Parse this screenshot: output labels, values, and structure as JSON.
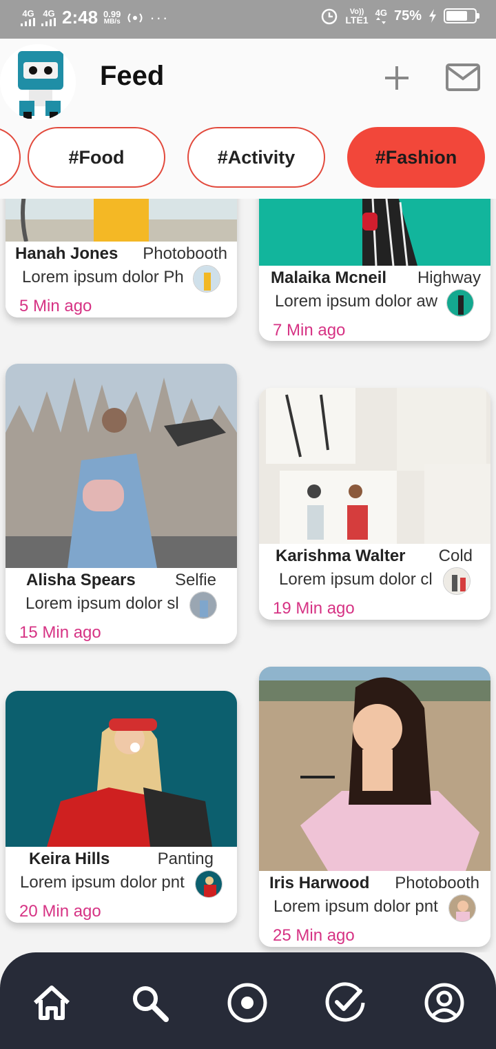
{
  "status_bar": {
    "sim1": "4G",
    "sim2": "4G",
    "time": "2:48",
    "speed_value": "0.99",
    "speed_unit": "MB/s",
    "overflow": "···",
    "volte": "Vo))",
    "lte": "LTE1",
    "net2": "4G",
    "battery_percent": "75%",
    "battery_level": 0.75
  },
  "header": {
    "title": "Feed"
  },
  "chips": [
    {
      "label": "#Food"
    },
    {
      "label": "#Activity"
    },
    {
      "label": "#Fashion",
      "active": true
    }
  ],
  "cards": [
    {
      "name": "Hanah Jones",
      "tag": "Photobooth",
      "desc": "Lorem ipsum dolor Ph",
      "time": "5 Min ago"
    },
    {
      "name": "Malaika Mcneil",
      "tag": "Highway",
      "desc": "Lorem ipsum dolor aw",
      "time": "7 Min ago"
    },
    {
      "name": "Alisha Spears",
      "tag": "Selfie",
      "desc": "Lorem ipsum dolor sl",
      "time": "15 Min ago"
    },
    {
      "name": "Karishma Walter",
      "tag": "Cold",
      "desc": "Lorem ipsum dolor cl",
      "time": "19 Min ago"
    },
    {
      "name": "Keira Hills",
      "tag": "Panting",
      "desc": "Lorem ipsum dolor pnt",
      "time": "20 Min ago"
    },
    {
      "name": "Iris Harwood",
      "tag": "Photobooth",
      "desc": "Lorem ipsum dolor pnt",
      "time": "25 Min ago"
    }
  ],
  "bottom_nav": [
    {
      "icon": "home-icon"
    },
    {
      "icon": "search-icon"
    },
    {
      "icon": "record-icon"
    },
    {
      "icon": "check-circle-icon"
    },
    {
      "icon": "profile-icon"
    }
  ],
  "colors": {
    "accent": "#f2473a",
    "time_text": "#d63384",
    "nav_bg": "#272b38"
  }
}
